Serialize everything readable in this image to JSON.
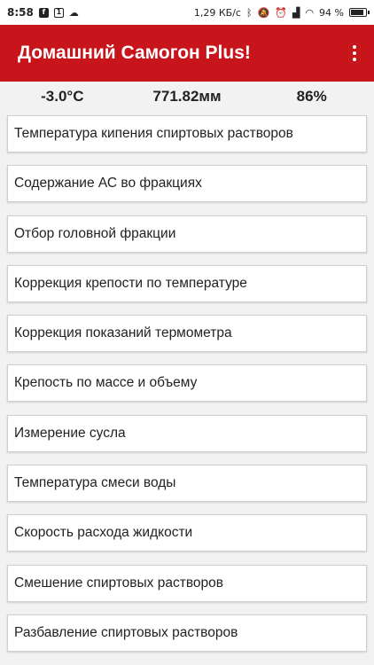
{
  "status_bar": {
    "time": "8:58",
    "fb_icon": "facebook-icon",
    "notification_icon": "notification-icon",
    "cloud_icon": "cloud-icon",
    "speed": "1,29 КБ/с",
    "battery_percent": "94 %",
    "battery_level": 0.94
  },
  "app_bar": {
    "title": "Домашний Самогон Plus!",
    "overflow_icon": "more-vertical-icon"
  },
  "readings": {
    "temperature": "-3.0°C",
    "pressure": "771.82мм",
    "humidity": "86%"
  },
  "menu": {
    "items": [
      "Температура кипения спиртовых растворов",
      "Содержание АС во фракциях",
      "Отбор головной фракции",
      "Коррекция крепости по температуре",
      "Коррекция показаний термометра",
      "Крепость по массе и объему",
      "Измерение сусла",
      "Температура смеси воды",
      "Скорость расхода жидкости",
      "Смешение спиртовых растворов",
      "Разбавление спиртовых растворов"
    ]
  },
  "colors": {
    "accent": "#c8141b",
    "background": "#f2f2f2",
    "card": "#ffffff"
  }
}
